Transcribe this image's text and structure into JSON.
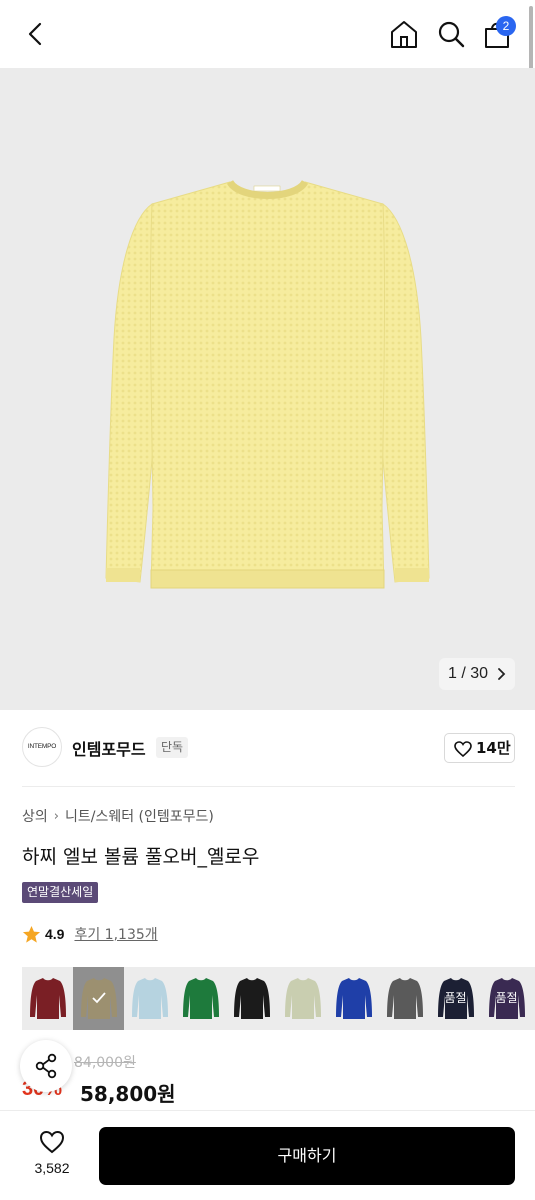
{
  "header": {
    "back_icon": "chevron-left-icon",
    "home_icon": "home-icon",
    "search_icon": "search-icon",
    "cart_icon": "shopping-bag-icon",
    "cart_count": "2"
  },
  "gallery": {
    "counter": "1 / 30",
    "product_color": "#f6ec9e"
  },
  "brand": {
    "logo_text": "INTEMPO",
    "name": "인템포무드",
    "exclusive_tag": "단독",
    "likes": "14만"
  },
  "product": {
    "breadcrumb": [
      "상의",
      "니트/스웨터 (인템포무드)"
    ],
    "title": "하찌 엘보 볼륨 풀오버_옐로우",
    "sale_tag": "연말결산세일",
    "rating": "4.9",
    "reviews": "후기 1,135개"
  },
  "swatches": [
    {
      "color": "#7a1f25",
      "selected": false,
      "soldout": false
    },
    {
      "color": "#9c9070",
      "selected": true,
      "soldout": false
    },
    {
      "color": "#b6d3e0",
      "selected": false,
      "soldout": false
    },
    {
      "color": "#1e7a3c",
      "selected": false,
      "soldout": false
    },
    {
      "color": "#1b1b1b",
      "selected": false,
      "soldout": false
    },
    {
      "color": "#c9ceb0",
      "selected": false,
      "soldout": false
    },
    {
      "color": "#1f3fa8",
      "selected": false,
      "soldout": false
    },
    {
      "color": "#5a5a5a",
      "selected": false,
      "soldout": false
    },
    {
      "color": "#1c2034",
      "selected": false,
      "soldout": true,
      "label": "품절"
    },
    {
      "color": "#3a2a52",
      "selected": false,
      "soldout": true,
      "label": "품절"
    }
  ],
  "price": {
    "original": "84,000원",
    "discount": "30%",
    "sale": "58,800원"
  },
  "footer": {
    "wish_count": "3,582",
    "buy_label": "구매하기"
  },
  "colors": {
    "accent_red": "#e2341d",
    "badge_blue": "#2a66f0",
    "sale_tag_purple": "#5b4a77"
  }
}
